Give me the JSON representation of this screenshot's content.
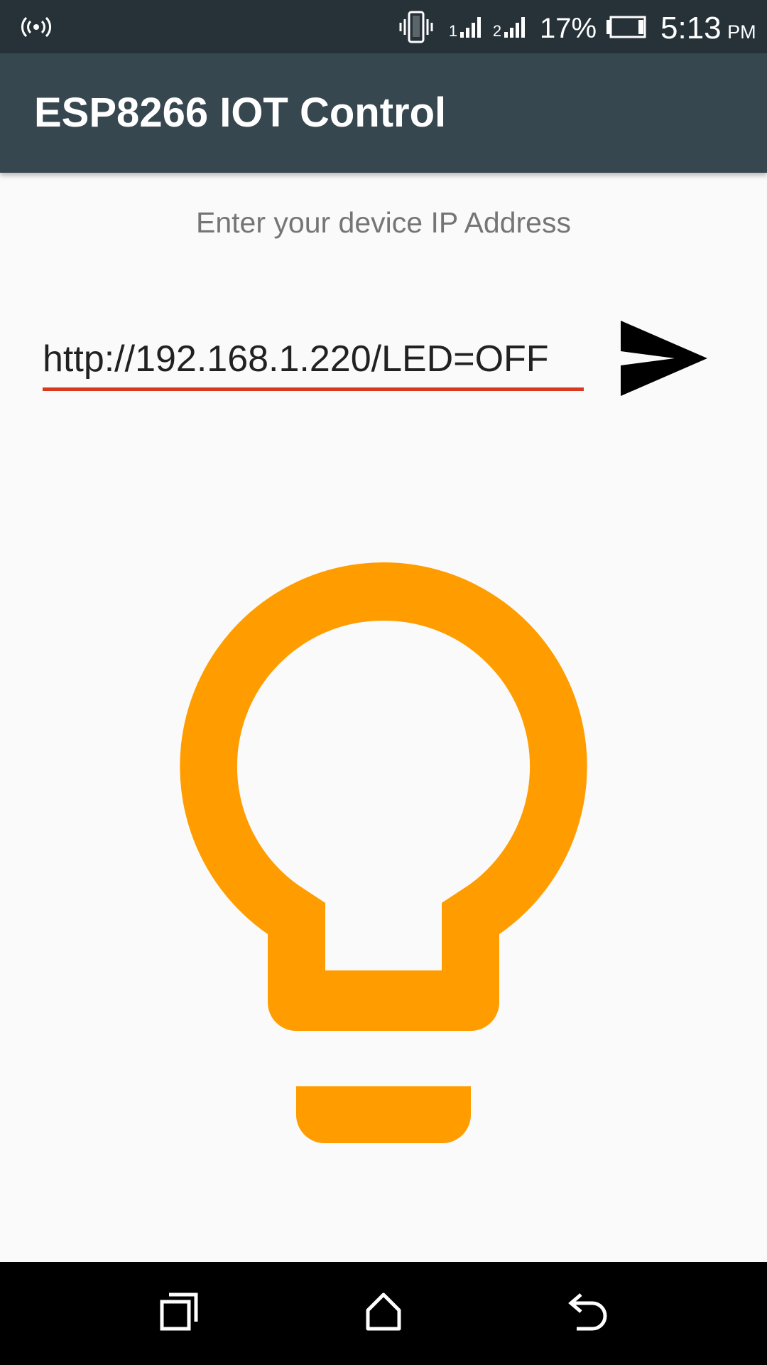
{
  "status_bar": {
    "icons": [
      "wifi-hotspot-icon",
      "vibrate-icon",
      "signal-sim1-icon",
      "signal-sim2-icon",
      "battery-icon"
    ],
    "sim1_label": "1",
    "sim2_label": "2",
    "battery_percent": "17%",
    "battery_level": 0.17,
    "time": "5:13",
    "ampm": "PM"
  },
  "app_bar": {
    "title": "ESP8266 IOT Control"
  },
  "main": {
    "prompt": "Enter your device IP Address",
    "url_value": "http://192.168.1.220/LED=OFF",
    "send_icon": "send-icon",
    "bulb_icon": "lightbulb-icon"
  },
  "nav_bar": {
    "icons": [
      "recents-icon",
      "home-icon",
      "back-icon"
    ]
  },
  "colors": {
    "status_bar": "#263238",
    "app_bar": "#37474f",
    "background": "#fafafa",
    "accent_underline": "#d9391f",
    "bulb": "#ff9d00",
    "prompt_text": "#757575",
    "nav_bar": "#000000"
  }
}
